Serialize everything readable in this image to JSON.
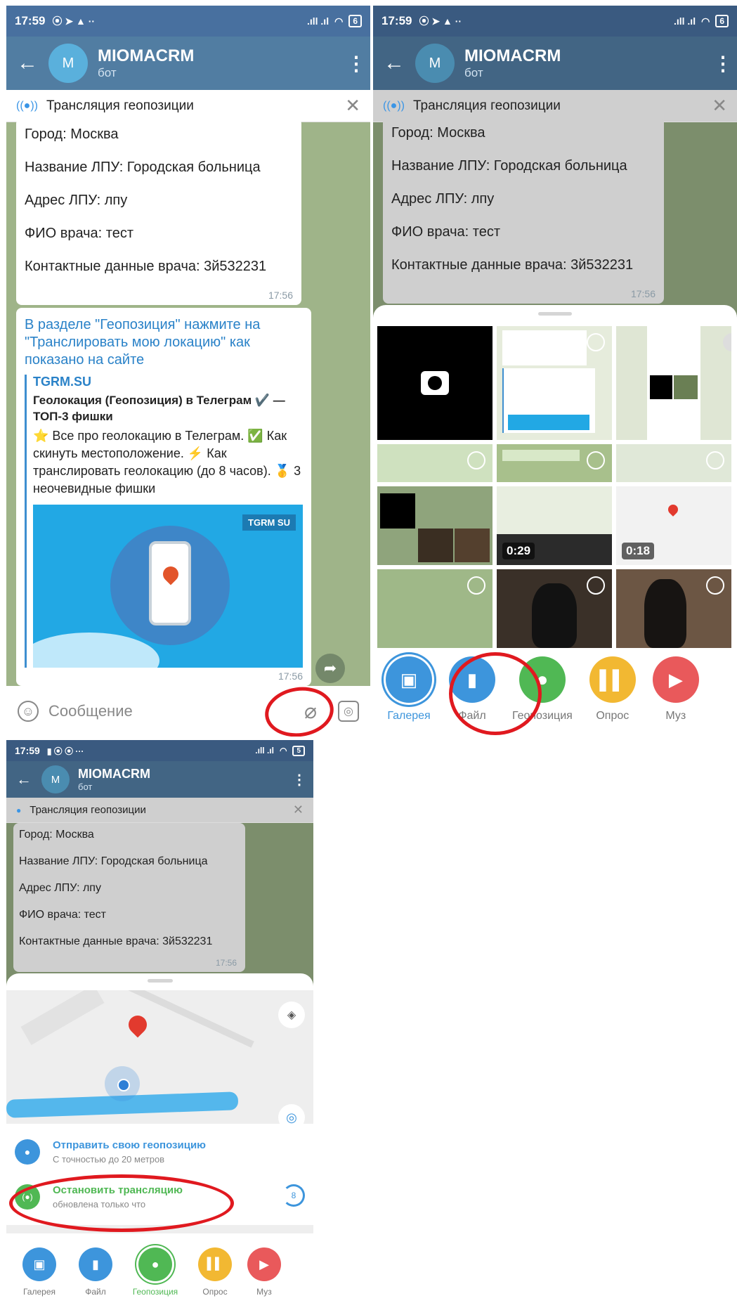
{
  "status_time": "17:59",
  "status_battery": "6",
  "status_battery_low": "5",
  "chat": {
    "name": "MIOMACRM",
    "subtitle": "бот",
    "avatar_letter": "M",
    "live_bar": "Трансляция геопозиции",
    "info_lines": [
      "Город: Москва",
      "Название ЛПУ: Городская больница",
      "Адрес ЛПУ: лпу",
      "ФИО врача: тест",
      "Контактные данные врача: 3й532231"
    ],
    "info_time": "17:56",
    "msg2_text": "В разделе \"Геопозиция\" нажмите на \"Транслировать мою локацию\" как показано на сайте",
    "preview_site": "TGRM.SU",
    "preview_title": "Геолокация (Геопозиция) в Телеграм ✔️ — ТОП-3 фишки",
    "preview_desc": "⭐ Все про геолокацию в Телеграм. ✅ Как скинуть местоположение. ⚡ Как транслировать геолокацию (до 8 часов). 🥇 3 неочевидные фишки",
    "preview_badge": "TGRM SU",
    "msg2_time": "17:56",
    "input_placeholder": "Сообщение"
  },
  "attach_tabs": [
    "Галерея",
    "Файл",
    "Геопозиция",
    "Опрос",
    "Муз"
  ],
  "gallery": {
    "dur1": "0:29",
    "dur2": "0:18"
  },
  "location": {
    "send_title": "Отправить свою геопозицию",
    "send_sub": "С точностью до 20 метров",
    "stop_title": "Остановить трансляцию",
    "stop_sub": "обновлена только что",
    "timer": "8"
  },
  "colors": {
    "header": "#517da2",
    "gallery": "#3d95dc",
    "file": "#3d95dc",
    "geo": "#50b854",
    "poll": "#f2b832",
    "music": "#e9595b",
    "annotation": "#e0191f"
  }
}
